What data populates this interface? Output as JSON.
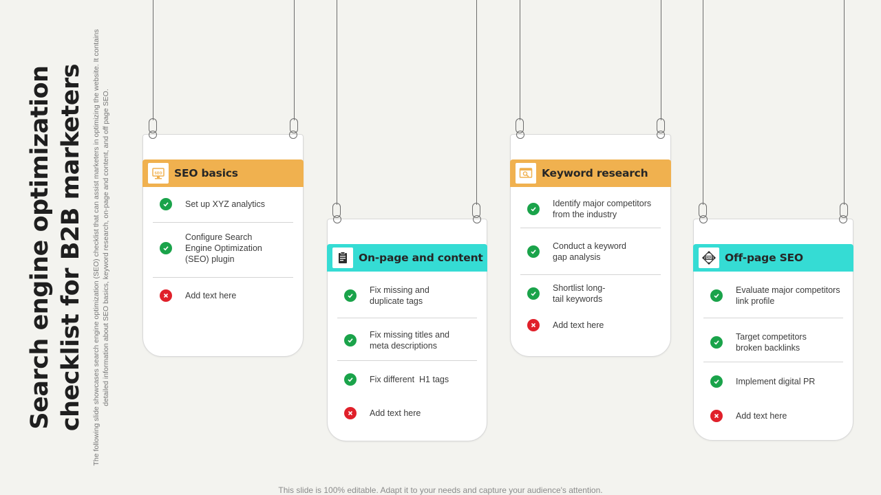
{
  "slide": {
    "title": "Search engine optimization checklist for B2B marketers",
    "subtitle": "The following slide showcases search engine optimization (SEO) checklist that can assist marketers in optimizing the website. It contains detailed information about SEO basics, keyword research, on-page and content, and off page SEO.",
    "footer": "This slide is 100% editable. Adapt it to your needs and capture your audience's attention."
  },
  "colors": {
    "orange": "#f0b14f",
    "teal": "#35dcd4",
    "check_green": "#1aa34a",
    "cross_red": "#e0202a"
  },
  "cards": [
    {
      "title": "SEO basics",
      "icon": "seo-monitor-icon",
      "items": [
        {
          "text": "Set up XYZ analytics",
          "status": "done"
        },
        {
          "text": "Configure Search\nEngine Optimization\n(SEO) plugin",
          "status": "done"
        },
        {
          "text": "Add text here",
          "status": "not-done"
        }
      ]
    },
    {
      "title": "On-page and content",
      "icon": "clipboard-icon",
      "items": [
        {
          "text": "Fix missing and\nduplicate tags",
          "status": "done"
        },
        {
          "text": "Fix missing titles and\nmeta descriptions",
          "status": "done"
        },
        {
          "text": "Fix different  H1 tags",
          "status": "done"
        },
        {
          "text": "Add text here",
          "status": "not-done"
        }
      ]
    },
    {
      "title": "Keyword research",
      "icon": "keyword-search-icon",
      "items": [
        {
          "text": "Identify major competitors\nfrom the industry",
          "status": "done"
        },
        {
          "text": "Conduct a keyword\ngap analysis",
          "status": "done"
        },
        {
          "text": "Shortlist long-\ntail keywords",
          "status": "done"
        },
        {
          "text": "Add text here",
          "status": "not-done"
        }
      ]
    },
    {
      "title": "Off-page SEO",
      "icon": "www-network-icon",
      "items": [
        {
          "text": "Evaluate major competitors\nlink profile",
          "status": "done"
        },
        {
          "text": "Target competitors\nbroken backlinks",
          "status": "done"
        },
        {
          "text": "Implement digital PR",
          "status": "done"
        },
        {
          "text": "Add text here",
          "status": "not-done"
        }
      ]
    }
  ]
}
